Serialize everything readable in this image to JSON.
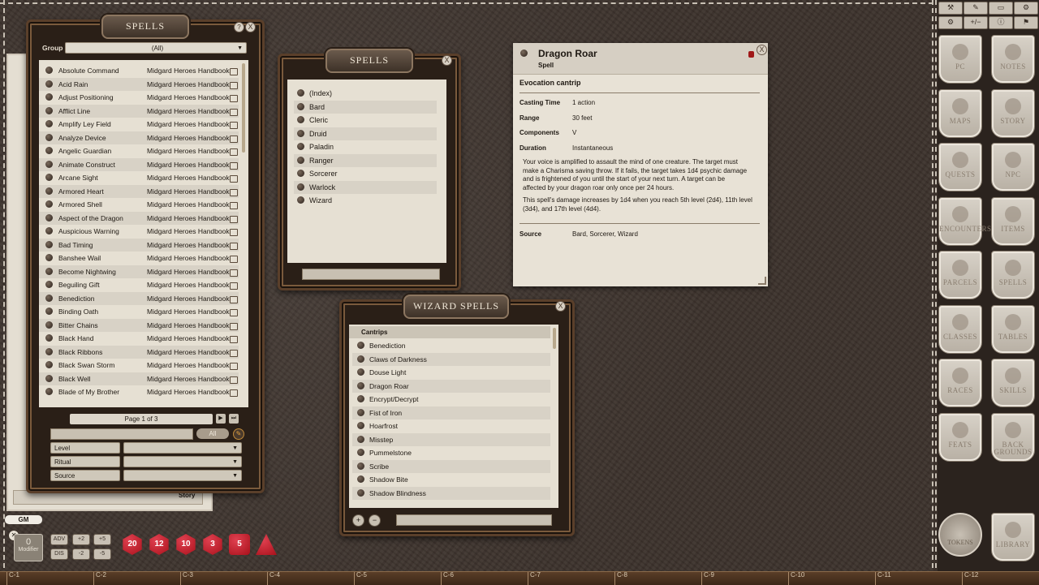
{
  "spells_panel": {
    "title": "SPELLS",
    "help_label": "?",
    "close_label": "X",
    "group_label": "Group",
    "group_value": "(All)",
    "items": [
      {
        "name": "Absolute Command",
        "source": "Midgard Heroes Handbook"
      },
      {
        "name": "Acid Rain",
        "source": "Midgard Heroes Handbook"
      },
      {
        "name": "Adjust Positioning",
        "source": "Midgard Heroes Handbook"
      },
      {
        "name": "Afflict Line",
        "source": "Midgard Heroes Handbook"
      },
      {
        "name": "Amplify Ley Field",
        "source": "Midgard Heroes Handbook"
      },
      {
        "name": "Analyze Device",
        "source": "Midgard Heroes Handbook"
      },
      {
        "name": "Angelic Guardian",
        "source": "Midgard Heroes Handbook"
      },
      {
        "name": "Animate Construct",
        "source": "Midgard Heroes Handbook"
      },
      {
        "name": "Arcane Sight",
        "source": "Midgard Heroes Handbook"
      },
      {
        "name": "Armored Heart",
        "source": "Midgard Heroes Handbook"
      },
      {
        "name": "Armored Shell",
        "source": "Midgard Heroes Handbook"
      },
      {
        "name": "Aspect of the Dragon",
        "source": "Midgard Heroes Handbook"
      },
      {
        "name": "Auspicious Warning",
        "source": "Midgard Heroes Handbook"
      },
      {
        "name": "Bad Timing",
        "source": "Midgard Heroes Handbook"
      },
      {
        "name": "Banshee Wail",
        "source": "Midgard Heroes Handbook"
      },
      {
        "name": "Become Nightwing",
        "source": "Midgard Heroes Handbook"
      },
      {
        "name": "Beguiling Gift",
        "source": "Midgard Heroes Handbook"
      },
      {
        "name": "Benediction",
        "source": "Midgard Heroes Handbook"
      },
      {
        "name": "Binding Oath",
        "source": "Midgard Heroes Handbook"
      },
      {
        "name": "Bitter Chains",
        "source": "Midgard Heroes Handbook"
      },
      {
        "name": "Black Hand",
        "source": "Midgard Heroes Handbook"
      },
      {
        "name": "Black Ribbons",
        "source": "Midgard Heroes Handbook"
      },
      {
        "name": "Black Swan Storm",
        "source": "Midgard Heroes Handbook"
      },
      {
        "name": "Black Well",
        "source": "Midgard Heroes Handbook"
      },
      {
        "name": "Blade of My Brother",
        "source": "Midgard Heroes Handbook"
      }
    ],
    "page_label": "Page 1 of 3",
    "all_label": "All",
    "filters": [
      "Level",
      "Ritual",
      "Source"
    ],
    "story_label": "Story"
  },
  "class_panel": {
    "title": "SPELLS",
    "close_label": "X",
    "items": [
      "(Index)",
      "Bard",
      "Cleric",
      "Druid",
      "Paladin",
      "Ranger",
      "Sorcerer",
      "Warlock",
      "Wizard"
    ]
  },
  "wizard_panel": {
    "title": "WIZARD SPELLS",
    "close_label": "X",
    "section": "Cantrips",
    "items": [
      "Benediction",
      "Claws of Darkness",
      "Douse Light",
      "Dragon Roar",
      "Encrypt/Decrypt",
      "Fist of Iron",
      "Hoarfrost",
      "Misstep",
      "Pummelstone",
      "Scribe",
      "Shadow Bite",
      "Shadow Blindness"
    ],
    "add_label": "+",
    "remove_label": "−"
  },
  "record": {
    "name": "Dragon Roar",
    "type": "Spell",
    "school": "Evocation cantrip",
    "fields": [
      {
        "label": "Casting Time",
        "value": "1 action"
      },
      {
        "label": "Range",
        "value": "30 feet"
      },
      {
        "label": "Components",
        "value": "V"
      },
      {
        "label": "Duration",
        "value": "Instantaneous"
      }
    ],
    "desc1_l1": "Your voice is amplified to assault the mind of one creature. The target must",
    "desc1_l2": "make a Charisma saving throw. If it fails, the target takes 1d4 psychic damage",
    "desc1_l3": "and is frightened of you until the start of your next turn. A target can be",
    "desc1_l4": "affected by your dragon roar only once per 24 hours.",
    "desc2_l1": "This spell's damage increases by 1d4 when you reach 5th level (2d4), 11th level",
    "desc2_l2": "(3d4), and 17th level (4d4).",
    "source_label": "Source",
    "source_value": "Bard, Sorcerer, Wizard"
  },
  "sidebar": {
    "top_buttons": [
      "⚒",
      "✎",
      "▭",
      "⚙",
      "⚙",
      "+/−",
      "ⓘ",
      "⚑"
    ],
    "buttons": [
      {
        "label": "PC",
        "icon": "helmet-icon"
      },
      {
        "label": "NOTES",
        "icon": "quill-icon"
      },
      {
        "label": "MAPS",
        "icon": "map-icon"
      },
      {
        "label": "STORY",
        "icon": "masks-icon"
      },
      {
        "label": "QUESTS",
        "icon": "masks-icon"
      },
      {
        "label": "NPC",
        "icon": "demon-icon"
      },
      {
        "label": "ENCOUNTERS",
        "icon": "demon-icon"
      },
      {
        "label": "ITEMS",
        "icon": "items-icon"
      },
      {
        "label": "PARCELS",
        "icon": "parcel-icon"
      },
      {
        "label": "SPELLS",
        "icon": "book-icon"
      },
      {
        "label": "CLASSES",
        "icon": "book-icon"
      },
      {
        "label": "TABLES",
        "icon": "book-icon"
      },
      {
        "label": "RACES",
        "icon": "book-icon"
      },
      {
        "label": "SKILLS",
        "icon": "book-icon"
      },
      {
        "label": "FEATS",
        "icon": "book-icon"
      },
      {
        "label": "BACK GROUNDS",
        "icon": "book-icon"
      }
    ],
    "tokens_label": "TOKENS",
    "library_label": "LIBRARY"
  },
  "toolbar": {
    "gm_label": "GM",
    "modifier_value": "0",
    "modifier_label": "Modifier",
    "adv_label": "ADV",
    "dis_label": "DIS",
    "mods": [
      "+2",
      "+5",
      "-2",
      "-5"
    ],
    "dice": [
      "d20",
      "d12",
      "d10",
      "d8",
      "d6",
      "d4"
    ],
    "dice_labels": [
      "20",
      "12",
      "10",
      "3",
      "5",
      ""
    ],
    "dice_color": "#a8101a"
  },
  "ruler": [
    "C-1",
    "C-2",
    "C-3",
    "C-4",
    "C-5",
    "C-6",
    "C-7",
    "C-8",
    "C-9",
    "C-10",
    "C-11",
    "C-12"
  ]
}
